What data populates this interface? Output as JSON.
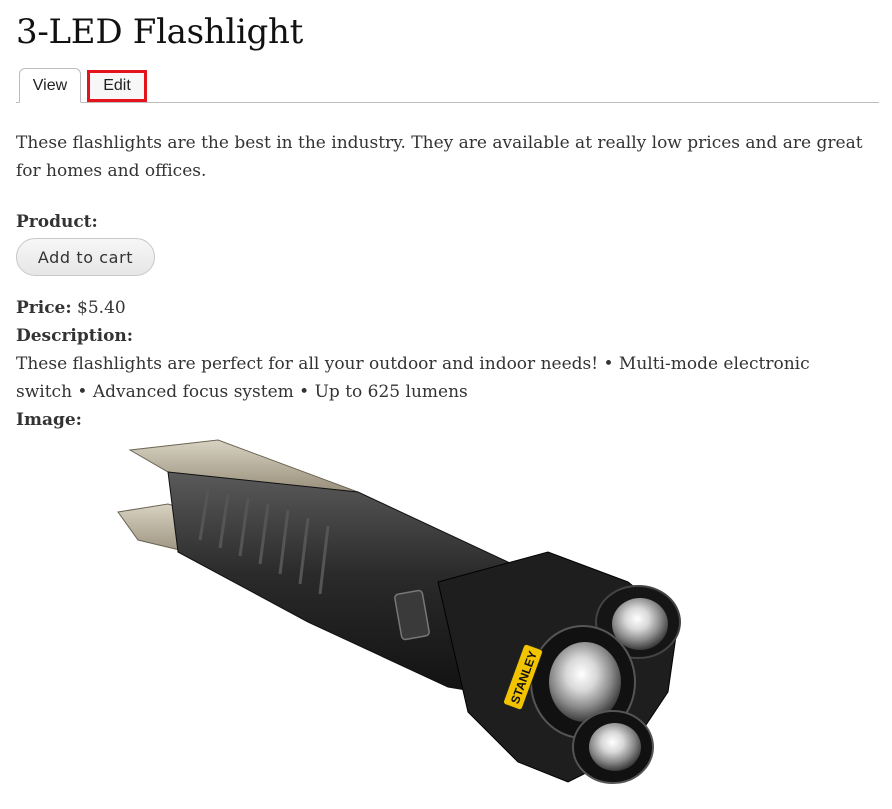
{
  "page": {
    "title": "3-LED Flashlight"
  },
  "tabs": [
    {
      "label": "View",
      "active": true
    },
    {
      "label": "Edit",
      "active": false,
      "highlighted": true
    }
  ],
  "intro": "These flashlights are the best in the industry. They are available at really low prices and are great for homes and offices.",
  "product": {
    "label": "Product:",
    "add_to_cart_label": "Add to cart"
  },
  "price": {
    "label": "Price:",
    "value": "$5.40"
  },
  "description": {
    "label": "Description:",
    "text": "These flashlights are perfect for all your outdoor and indoor needs! • Multi-mode electronic switch • Advanced focus system • Up to 625 lumens"
  },
  "image": {
    "label": "Image:",
    "brand_text": "STANLEY",
    "icon": "flashlight-image"
  },
  "colors": {
    "highlight": "#e3141b",
    "brand_yellow": "#f2c400"
  }
}
